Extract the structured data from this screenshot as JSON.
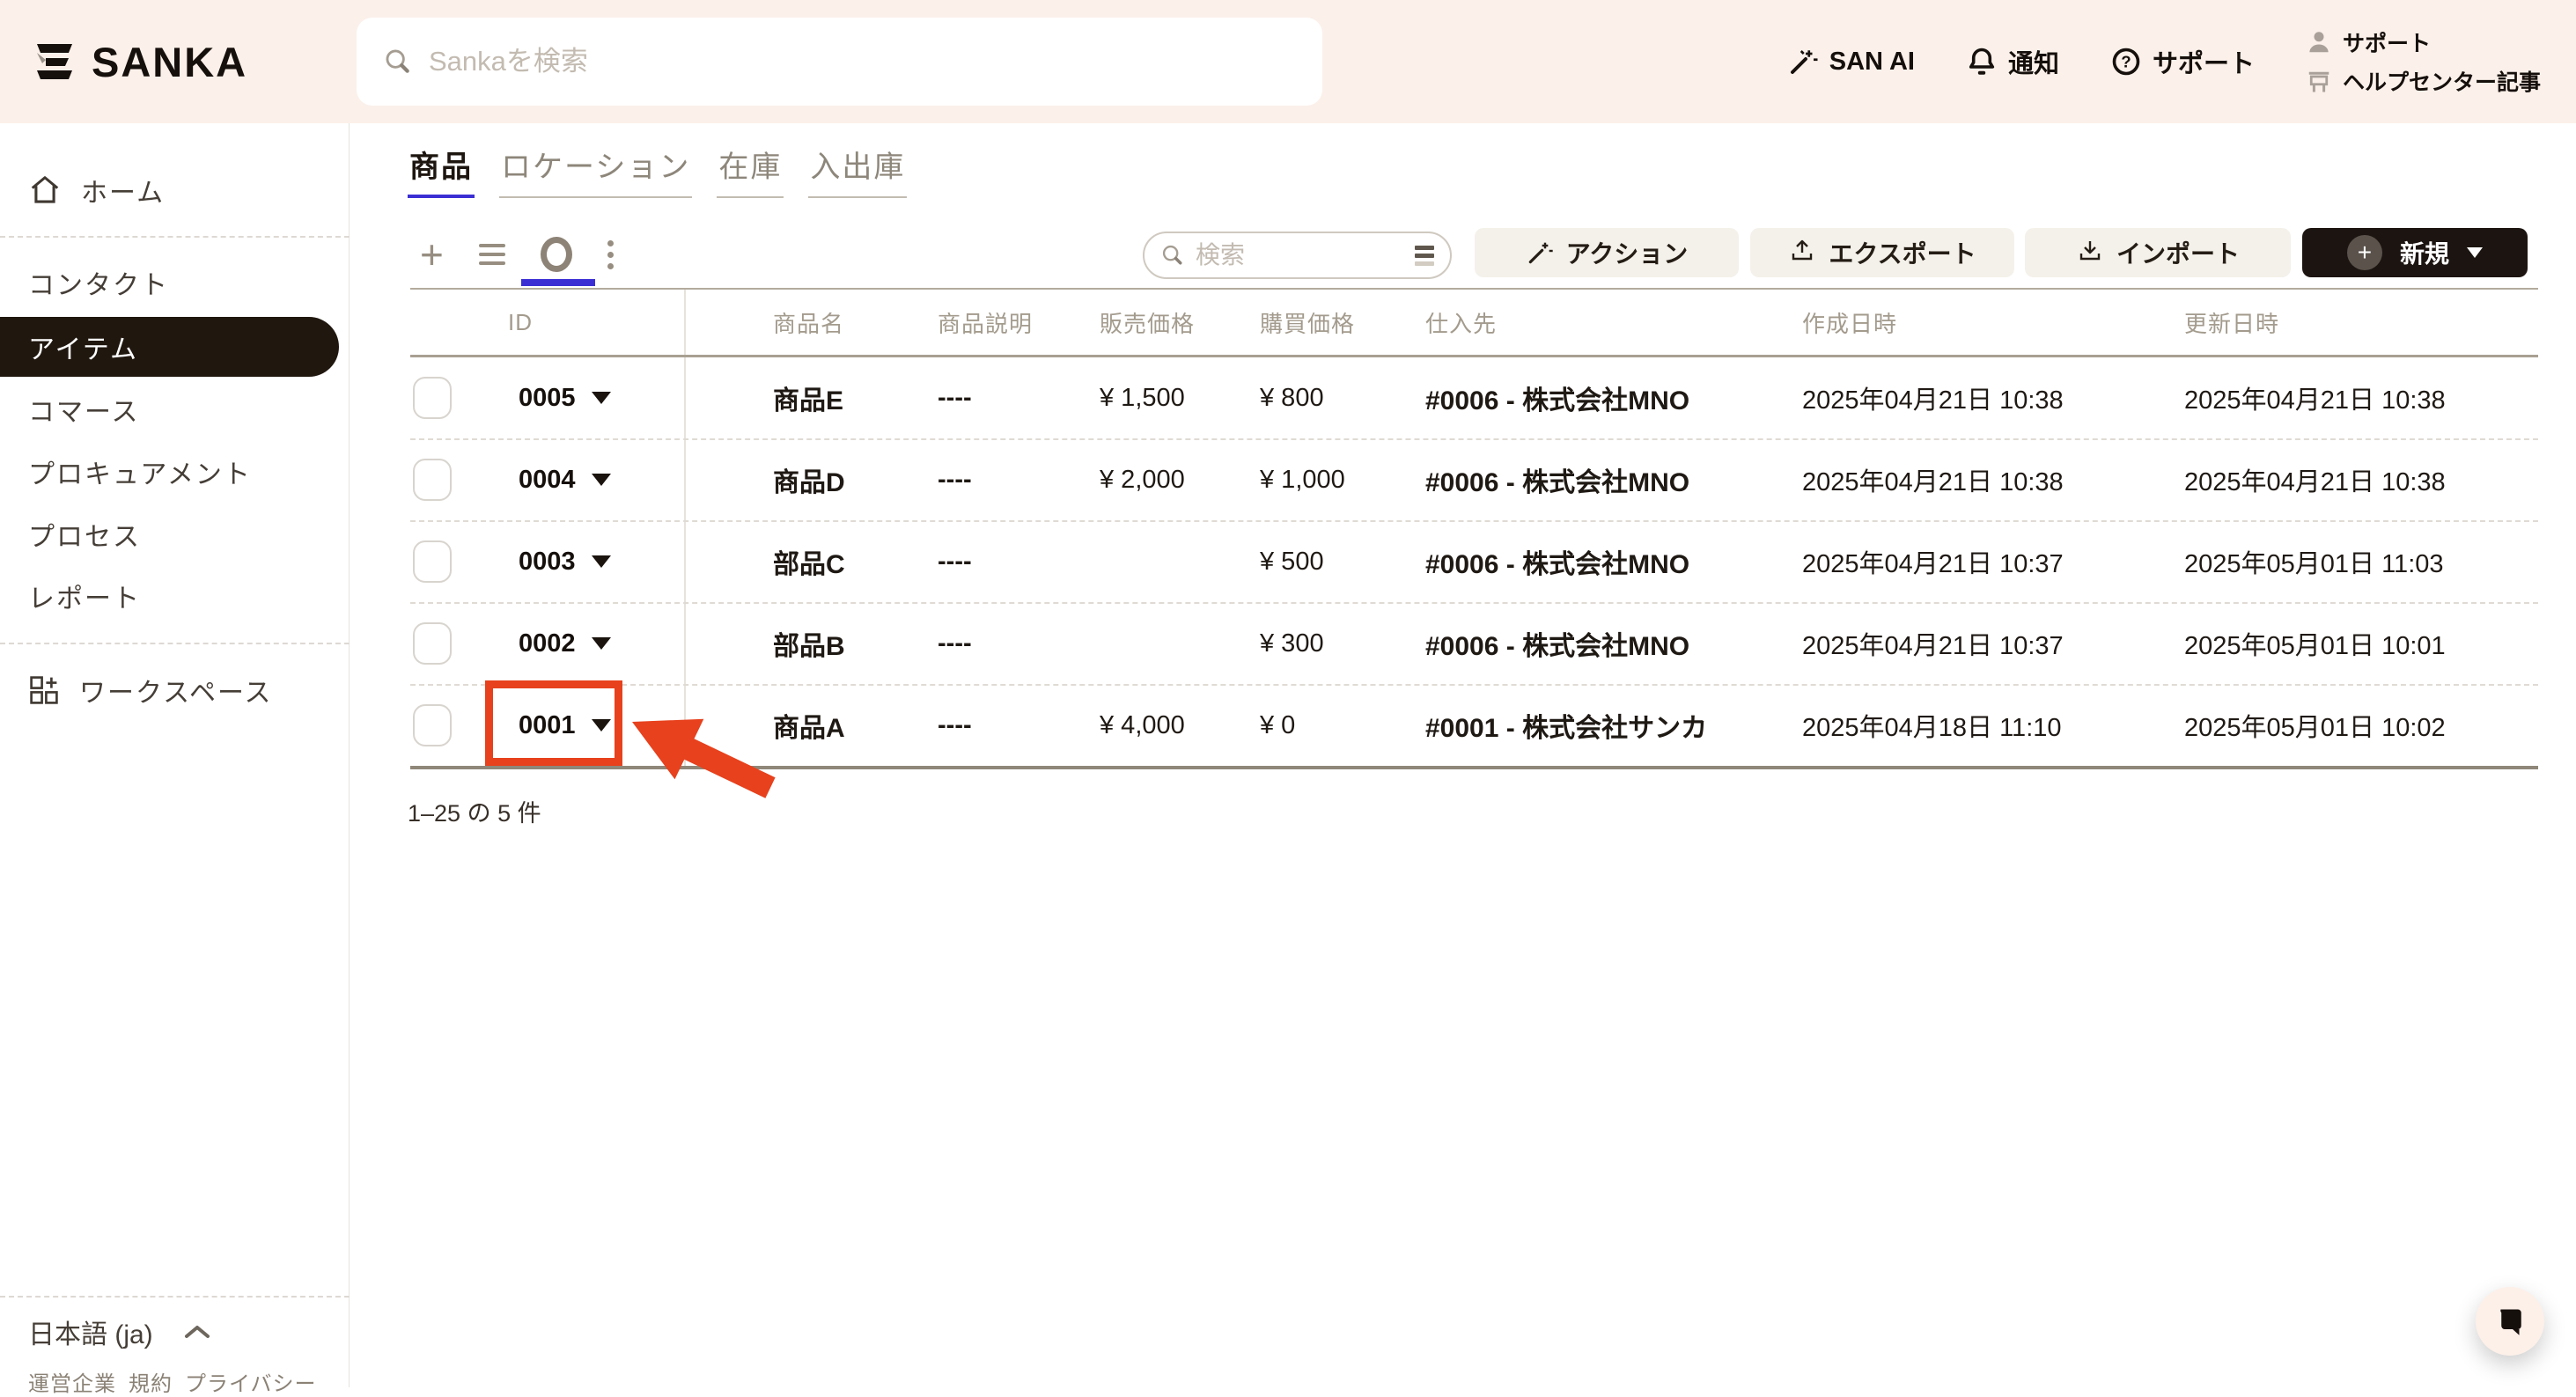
{
  "brand": {
    "name": "SANKA"
  },
  "header": {
    "search_placeholder": "Sankaを検索",
    "nav": [
      {
        "label": "SAN AI",
        "icon": "wand-icon"
      },
      {
        "label": "通知",
        "icon": "bell-icon"
      },
      {
        "label": "サポート",
        "icon": "help-circle-icon"
      }
    ],
    "account": {
      "line1": "サポート",
      "line2": "ヘルプセンター記事"
    }
  },
  "sidebar": {
    "items": [
      {
        "label": "ホーム"
      },
      {
        "label": "コンタクト"
      },
      {
        "label": "アイテム",
        "active": true
      },
      {
        "label": "コマース"
      },
      {
        "label": "プロキュアメント"
      },
      {
        "label": "プロセス"
      },
      {
        "label": "レポート"
      },
      {
        "label": "ワークスペース"
      }
    ],
    "footer": {
      "language": "日本語 (ja)",
      "links": [
        "運営企業",
        "規約",
        "プライバシー"
      ]
    }
  },
  "tabs": [
    {
      "label": "商品",
      "active": true
    },
    {
      "label": "ロケーション"
    },
    {
      "label": "在庫"
    },
    {
      "label": "入出庫"
    }
  ],
  "toolbar": {
    "search_placeholder": "検索",
    "buttons": [
      {
        "label": "アクション"
      },
      {
        "label": "エクスポート"
      },
      {
        "label": "インポート"
      },
      {
        "label": "新規"
      }
    ]
  },
  "table": {
    "columns": [
      "ID",
      "商品名",
      "商品説明",
      "販売価格",
      "購買価格",
      "仕入先",
      "作成日時",
      "更新日時"
    ],
    "rows": [
      {
        "id": "0005",
        "name": "商品E",
        "description": "----",
        "sale_price": "¥ 1,500",
        "purchase_price": "¥ 800",
        "supplier": "#0006 - 株式会社MNO",
        "created_at": "2025年04月21日 10:38",
        "updated_at": "2025年04月21日 10:38"
      },
      {
        "id": "0004",
        "name": "商品D",
        "description": "----",
        "sale_price": "¥ 2,000",
        "purchase_price": "¥ 1,000",
        "supplier": "#0006 - 株式会社MNO",
        "created_at": "2025年04月21日 10:38",
        "updated_at": "2025年04月21日 10:38"
      },
      {
        "id": "0003",
        "name": "部品C",
        "description": "----",
        "sale_price": "",
        "purchase_price": "¥ 500",
        "supplier": "#0006 - 株式会社MNO",
        "created_at": "2025年04月21日 10:37",
        "updated_at": "2025年05月01日 11:03"
      },
      {
        "id": "0002",
        "name": "部品B",
        "description": "----",
        "sale_price": "",
        "purchase_price": "¥ 300",
        "supplier": "#0006 - 株式会社MNO",
        "created_at": "2025年04月21日 10:37",
        "updated_at": "2025年05月01日 10:01"
      },
      {
        "id": "0001",
        "name": "商品A",
        "description": "----",
        "sale_price": "¥ 4,000",
        "purchase_price": "¥ 0",
        "supplier": "#0001 - 株式会社サンカ",
        "created_at": "2025年04月18日 11:10",
        "updated_at": "2025年05月01日 10:02"
      }
    ]
  },
  "pagination": {
    "summary": "1–25 の 5 件"
  },
  "annotation": {
    "type": "red-highlight-box-with-arrow",
    "target_id": "0001"
  },
  "colors": {
    "accent": "#3b2fd4",
    "annotation_red": "#e7411d",
    "header_bg": "#fbf0ea",
    "dark_button": "#1c1410"
  }
}
